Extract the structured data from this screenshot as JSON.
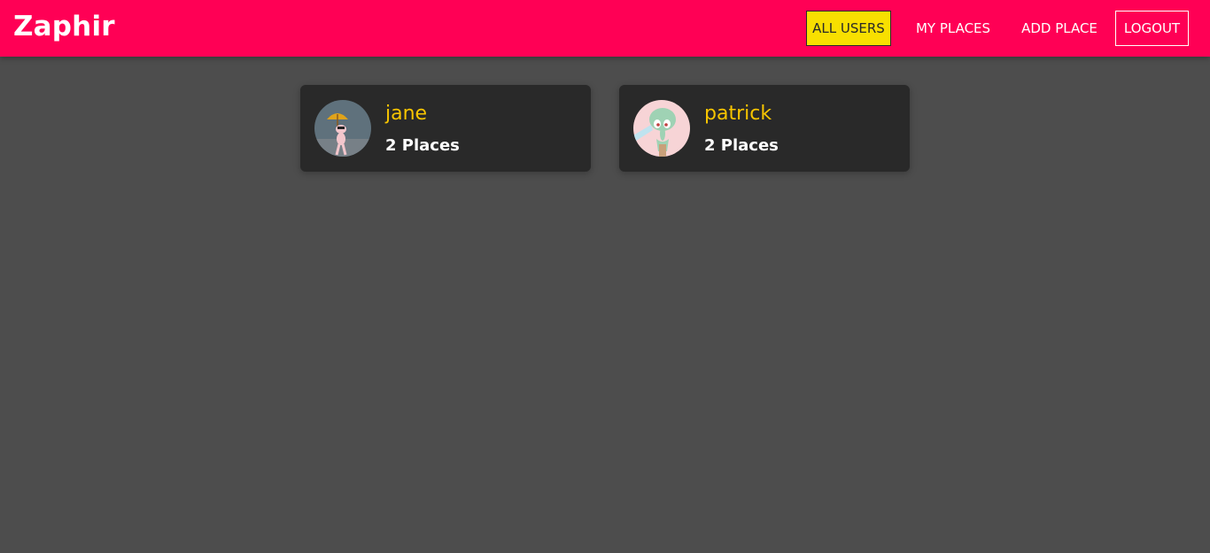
{
  "app": {
    "brand": "Zaphir"
  },
  "nav": {
    "items": [
      {
        "label": "ALL USERS",
        "active": true
      },
      {
        "label": "MY PLACES",
        "active": false
      },
      {
        "label": "ADD PLACE",
        "active": false
      },
      {
        "label": "LOGOUT",
        "active": false
      }
    ]
  },
  "users": [
    {
      "name": "jane",
      "places": "2 Places",
      "avatar": "umbrella-character-avatar"
    },
    {
      "name": "patrick",
      "places": "2 Places",
      "avatar": "squidward-avatar"
    }
  ],
  "colors": {
    "header": "#ff0055",
    "background": "#4d4d4d",
    "card": "#292929",
    "accent_yellow": "#f8df00",
    "name_yellow": "#f8c500"
  }
}
